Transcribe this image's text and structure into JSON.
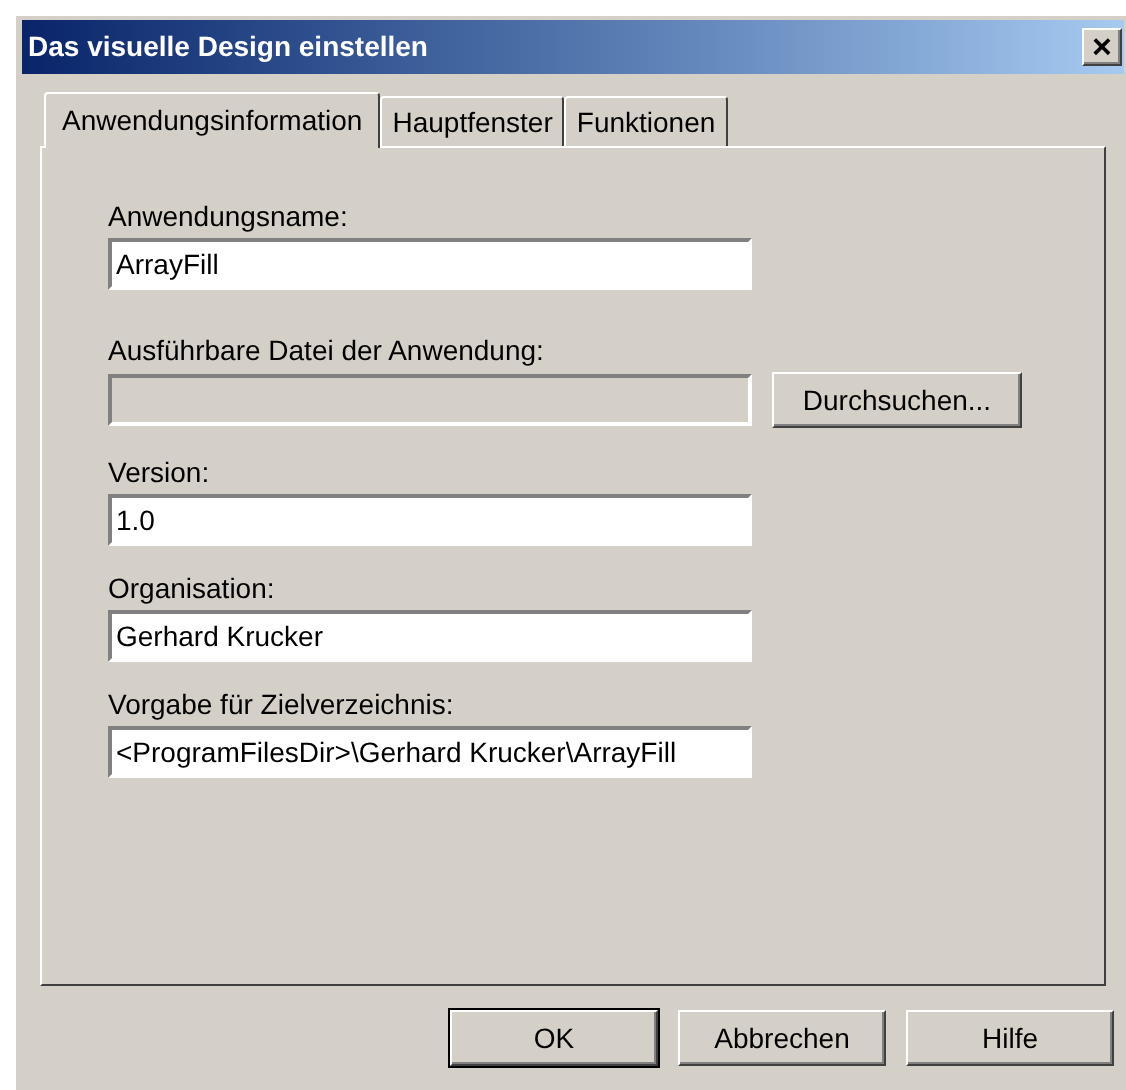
{
  "window": {
    "title": "Das visuelle Design einstellen",
    "close": "×"
  },
  "tabs": [
    {
      "label": "Anwendungsinformation",
      "selected": true
    },
    {
      "label": "Hauptfenster",
      "selected": false
    },
    {
      "label": "Funktionen",
      "selected": false
    }
  ],
  "fields": [
    {
      "label": "Anwendungsname:",
      "value": "ArrayFill",
      "disabled": false
    },
    {
      "label": "Ausführbare Datei der Anwendung:",
      "disabled": true,
      "button": {
        "label": "Durchsuchen..."
      }
    },
    {
      "label": "Version:",
      "value": "1.0",
      "disabled": false
    },
    {
      "label": "Organisation:",
      "value": "Gerhard Krucker",
      "disabled": false
    },
    {
      "label": "Vorgabe für Zielverzeichnis:",
      "value": "<ProgramFilesDir>\\Gerhard Krucker\\ArrayFill",
      "disabled": false
    }
  ],
  "buttons": [
    {
      "label": "OK",
      "default": true
    },
    {
      "label": "Abbrechen",
      "default": false
    },
    {
      "label": "Hilfe",
      "default": false
    }
  ]
}
